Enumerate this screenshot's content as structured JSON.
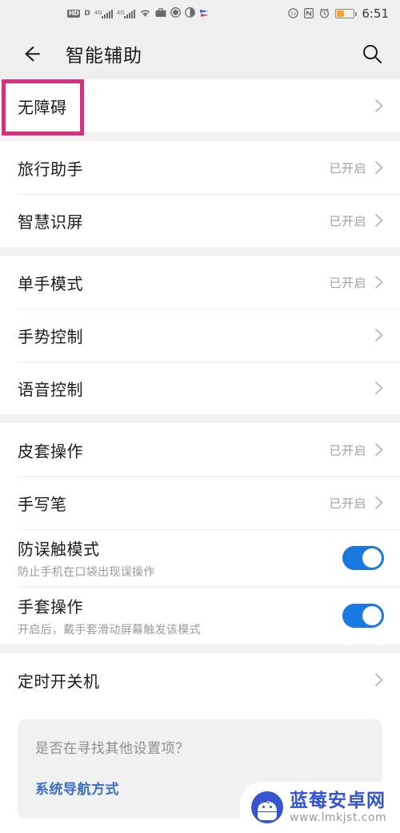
{
  "statusbar": {
    "icons_left": [
      {
        "name": "hd-voice-icon",
        "label": "HD"
      },
      {
        "name": "volte-icon",
        "label": "D"
      },
      {
        "name": "signal-sim1-icon",
        "label": "4G"
      },
      {
        "name": "signal-sim2-icon",
        "label": "4G"
      },
      {
        "name": "wifi-icon",
        "label": "◢"
      },
      {
        "name": "work-profile-icon",
        "label": "💼"
      },
      {
        "name": "shield-icon",
        "label": "⬢"
      },
      {
        "name": "do-not-disturb-icon",
        "label": "◑"
      },
      {
        "name": "app-badge-icon",
        "label": "➤"
      }
    ],
    "icons_right": [
      {
        "name": "screen-record-icon",
        "label": "③"
      },
      {
        "name": "nfc-icon",
        "label": "N"
      },
      {
        "name": "alarm-icon",
        "label": "⏱"
      }
    ],
    "battery_percent": 38,
    "battery_color": "#f5a623",
    "time": "6:51"
  },
  "appbar": {
    "back_icon": "back-arrow-icon",
    "title": "智能辅助",
    "search_icon": "search-icon"
  },
  "highlight": {
    "color": "#d6307e",
    "target": "无障碍"
  },
  "groups": [
    {
      "rows": [
        {
          "title": "无障碍",
          "value": "",
          "type": "chevron",
          "name": "row-accessibility"
        }
      ]
    },
    {
      "rows": [
        {
          "title": "旅行助手",
          "value": "已开启",
          "type": "chevron",
          "name": "row-travel-assistant"
        },
        {
          "title": "智慧识屏",
          "value": "已开启",
          "type": "chevron",
          "name": "row-smart-screen-recognition"
        }
      ]
    },
    {
      "rows": [
        {
          "title": "单手模式",
          "value": "已开启",
          "type": "chevron",
          "name": "row-one-hand-mode"
        },
        {
          "title": "手势控制",
          "value": "",
          "type": "chevron",
          "name": "row-gesture-control"
        },
        {
          "title": "语音控制",
          "value": "",
          "type": "chevron",
          "name": "row-voice-control"
        }
      ]
    },
    {
      "rows": [
        {
          "title": "皮套操作",
          "value": "已开启",
          "type": "chevron",
          "name": "row-case-operation"
        },
        {
          "title": "手写笔",
          "value": "已开启",
          "type": "chevron",
          "name": "row-stylus"
        },
        {
          "title": "防误触模式",
          "subtitle": "防止手机在口袋出现误操作",
          "type": "toggle",
          "toggle_on": true,
          "name": "row-accidental-touch-prevention"
        },
        {
          "title": "手套操作",
          "subtitle": "开启后，戴手套滑动屏幕触发该模式",
          "type": "toggle",
          "toggle_on": true,
          "name": "row-glove-mode"
        }
      ]
    },
    {
      "rows": [
        {
          "title": "定时开关机",
          "value": "",
          "type": "chevron",
          "name": "row-scheduled-power-on-off"
        }
      ]
    }
  ],
  "footer_card": {
    "question": "是否在寻找其他设置项？",
    "link": "系统导航方式",
    "link_color": "#3b6fc4"
  },
  "watermark": {
    "site_name": "蓝莓安卓网",
    "url": "www.lmkjst.com",
    "brand_color": "#3554d1"
  }
}
